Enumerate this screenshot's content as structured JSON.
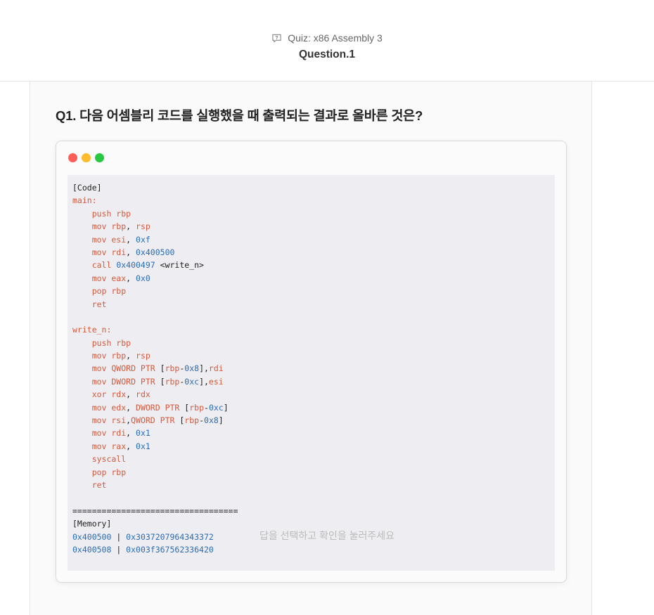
{
  "header": {
    "quiz_title": "Quiz: x86 Assembly 3",
    "question_label": "Question.1",
    "quiz_icon": "chat-question-icon"
  },
  "question": {
    "heading": "Q1. 다음 어셈블리 코드를 실행했을 때 출력되는 결과로 올바른 것은?"
  },
  "window_dots": {
    "colors": [
      "#ff5f57",
      "#febc2e",
      "#28c840"
    ]
  },
  "code": {
    "lines": [
      [
        [
          "[Code]",
          "plain"
        ]
      ],
      [
        [
          "main:",
          "red"
        ]
      ],
      [
        [
          "    push rbp",
          "red"
        ]
      ],
      [
        [
          "    mov rbp",
          "red"
        ],
        [
          ", ",
          "plain"
        ],
        [
          "rsp",
          "red"
        ]
      ],
      [
        [
          "    mov esi",
          "red"
        ],
        [
          ", ",
          "plain"
        ],
        [
          "0xf",
          "blue"
        ]
      ],
      [
        [
          "    mov rdi",
          "red"
        ],
        [
          ", ",
          "plain"
        ],
        [
          "0x400500",
          "blue"
        ]
      ],
      [
        [
          "    call ",
          "red"
        ],
        [
          "0x400497",
          "blue"
        ],
        [
          " <write_n>",
          "plain"
        ]
      ],
      [
        [
          "    mov eax",
          "red"
        ],
        [
          ", ",
          "plain"
        ],
        [
          "0x0",
          "blue"
        ]
      ],
      [
        [
          "    pop rbp",
          "red"
        ]
      ],
      [
        [
          "    ret",
          "red"
        ]
      ],
      [
        [
          "",
          "plain"
        ]
      ],
      [
        [
          "write_n:",
          "red"
        ]
      ],
      [
        [
          "    push rbp",
          "red"
        ]
      ],
      [
        [
          "    mov rbp",
          "red"
        ],
        [
          ", ",
          "plain"
        ],
        [
          "rsp",
          "red"
        ]
      ],
      [
        [
          "    mov QWORD PTR ",
          "red"
        ],
        [
          "[",
          "plain"
        ],
        [
          "rbp",
          "red"
        ],
        [
          "-",
          "plain"
        ],
        [
          "0x8",
          "blue"
        ],
        [
          "],",
          "plain"
        ],
        [
          "rdi",
          "red"
        ]
      ],
      [
        [
          "    mov DWORD PTR ",
          "red"
        ],
        [
          "[",
          "plain"
        ],
        [
          "rbp",
          "red"
        ],
        [
          "-",
          "plain"
        ],
        [
          "0xc",
          "blue"
        ],
        [
          "],",
          "plain"
        ],
        [
          "esi",
          "red"
        ]
      ],
      [
        [
          "    xor rdx",
          "red"
        ],
        [
          ", ",
          "plain"
        ],
        [
          "rdx",
          "red"
        ]
      ],
      [
        [
          "    mov edx",
          "red"
        ],
        [
          ", ",
          "plain"
        ],
        [
          "DWORD PTR ",
          "red"
        ],
        [
          "[",
          "plain"
        ],
        [
          "rbp",
          "red"
        ],
        [
          "-",
          "plain"
        ],
        [
          "0xc",
          "blue"
        ],
        [
          "]",
          "plain"
        ]
      ],
      [
        [
          "    mov rsi",
          "red"
        ],
        [
          ",",
          "plain"
        ],
        [
          "QWORD PTR ",
          "red"
        ],
        [
          "[",
          "plain"
        ],
        [
          "rbp",
          "red"
        ],
        [
          "-",
          "plain"
        ],
        [
          "0x8",
          "blue"
        ],
        [
          "]",
          "plain"
        ]
      ],
      [
        [
          "    mov rdi",
          "red"
        ],
        [
          ", ",
          "plain"
        ],
        [
          "0x1",
          "blue"
        ]
      ],
      [
        [
          "    mov rax",
          "red"
        ],
        [
          ", ",
          "plain"
        ],
        [
          "0x1",
          "blue"
        ]
      ],
      [
        [
          "    syscall",
          "red"
        ]
      ],
      [
        [
          "    pop rbp",
          "red"
        ]
      ],
      [
        [
          "    ret",
          "red"
        ]
      ],
      [
        [
          "",
          "plain"
        ]
      ],
      [
        [
          "==================================",
          "plain"
        ]
      ],
      [
        [
          "[Memory]",
          "plain"
        ]
      ],
      [
        [
          "0x400500",
          "blue"
        ],
        [
          " | ",
          "plain"
        ],
        [
          "0x3037207964343372",
          "blue"
        ]
      ],
      [
        [
          "0x400508",
          "blue"
        ],
        [
          " | ",
          "plain"
        ],
        [
          "0x003f367562336420",
          "blue"
        ]
      ]
    ]
  },
  "footer": {
    "hint_text": "답을 선택하고 확인을 눌러주세요"
  }
}
